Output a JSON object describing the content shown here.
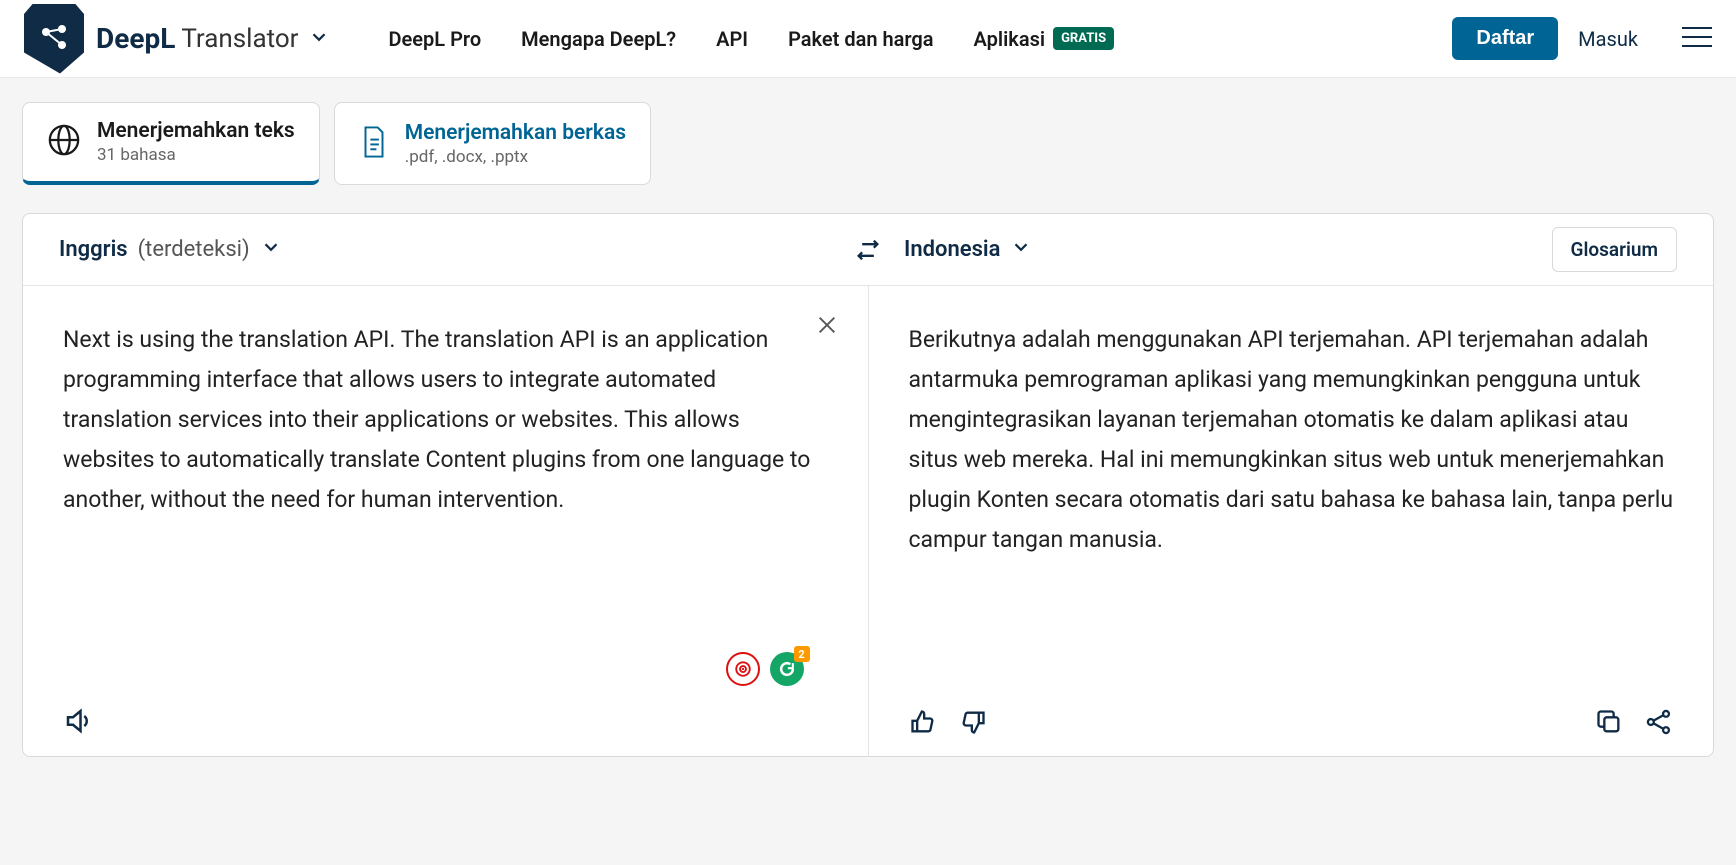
{
  "header": {
    "brand": "DeepL",
    "brand_suffix": "Translator",
    "nav": {
      "pro": "DeepL Pro",
      "why": "Mengapa DeepL?",
      "api": "API",
      "pricing": "Paket dan harga",
      "apps": "Aplikasi",
      "apps_badge": "GRATIS"
    },
    "auth": {
      "signup": "Daftar",
      "login": "Masuk"
    }
  },
  "tabs": {
    "text": {
      "title": "Menerjemahkan teks",
      "sub": "31 bahasa"
    },
    "file": {
      "title": "Menerjemahkan berkas",
      "sub": ".pdf, .docx, .pptx"
    }
  },
  "languages": {
    "source": "Inggris",
    "source_detected": "(terdeteksi)",
    "target": "Indonesia",
    "glossary": "Glosarium"
  },
  "source_text": "Next is using the translation API. The translation API is an application programming interface that allows users to integrate automated translation services into their applications or websites. This allows websites to automatically translate Content plugins from one language to another, without the need for human intervention.",
  "target_text": "Berikutnya adalah menggunakan API terjemahan. API terjemahan adalah antarmuka pemrograman aplikasi yang memungkinkan pengguna untuk mengintegrasikan layanan terjemahan otomatis ke dalam aplikasi atau situs web mereka. Hal ini memungkinkan situs web untuk menerjemahkan plugin Konten secara otomatis dari satu bahasa ke bahasa lain, tanpa perlu campur tangan manusia."
}
